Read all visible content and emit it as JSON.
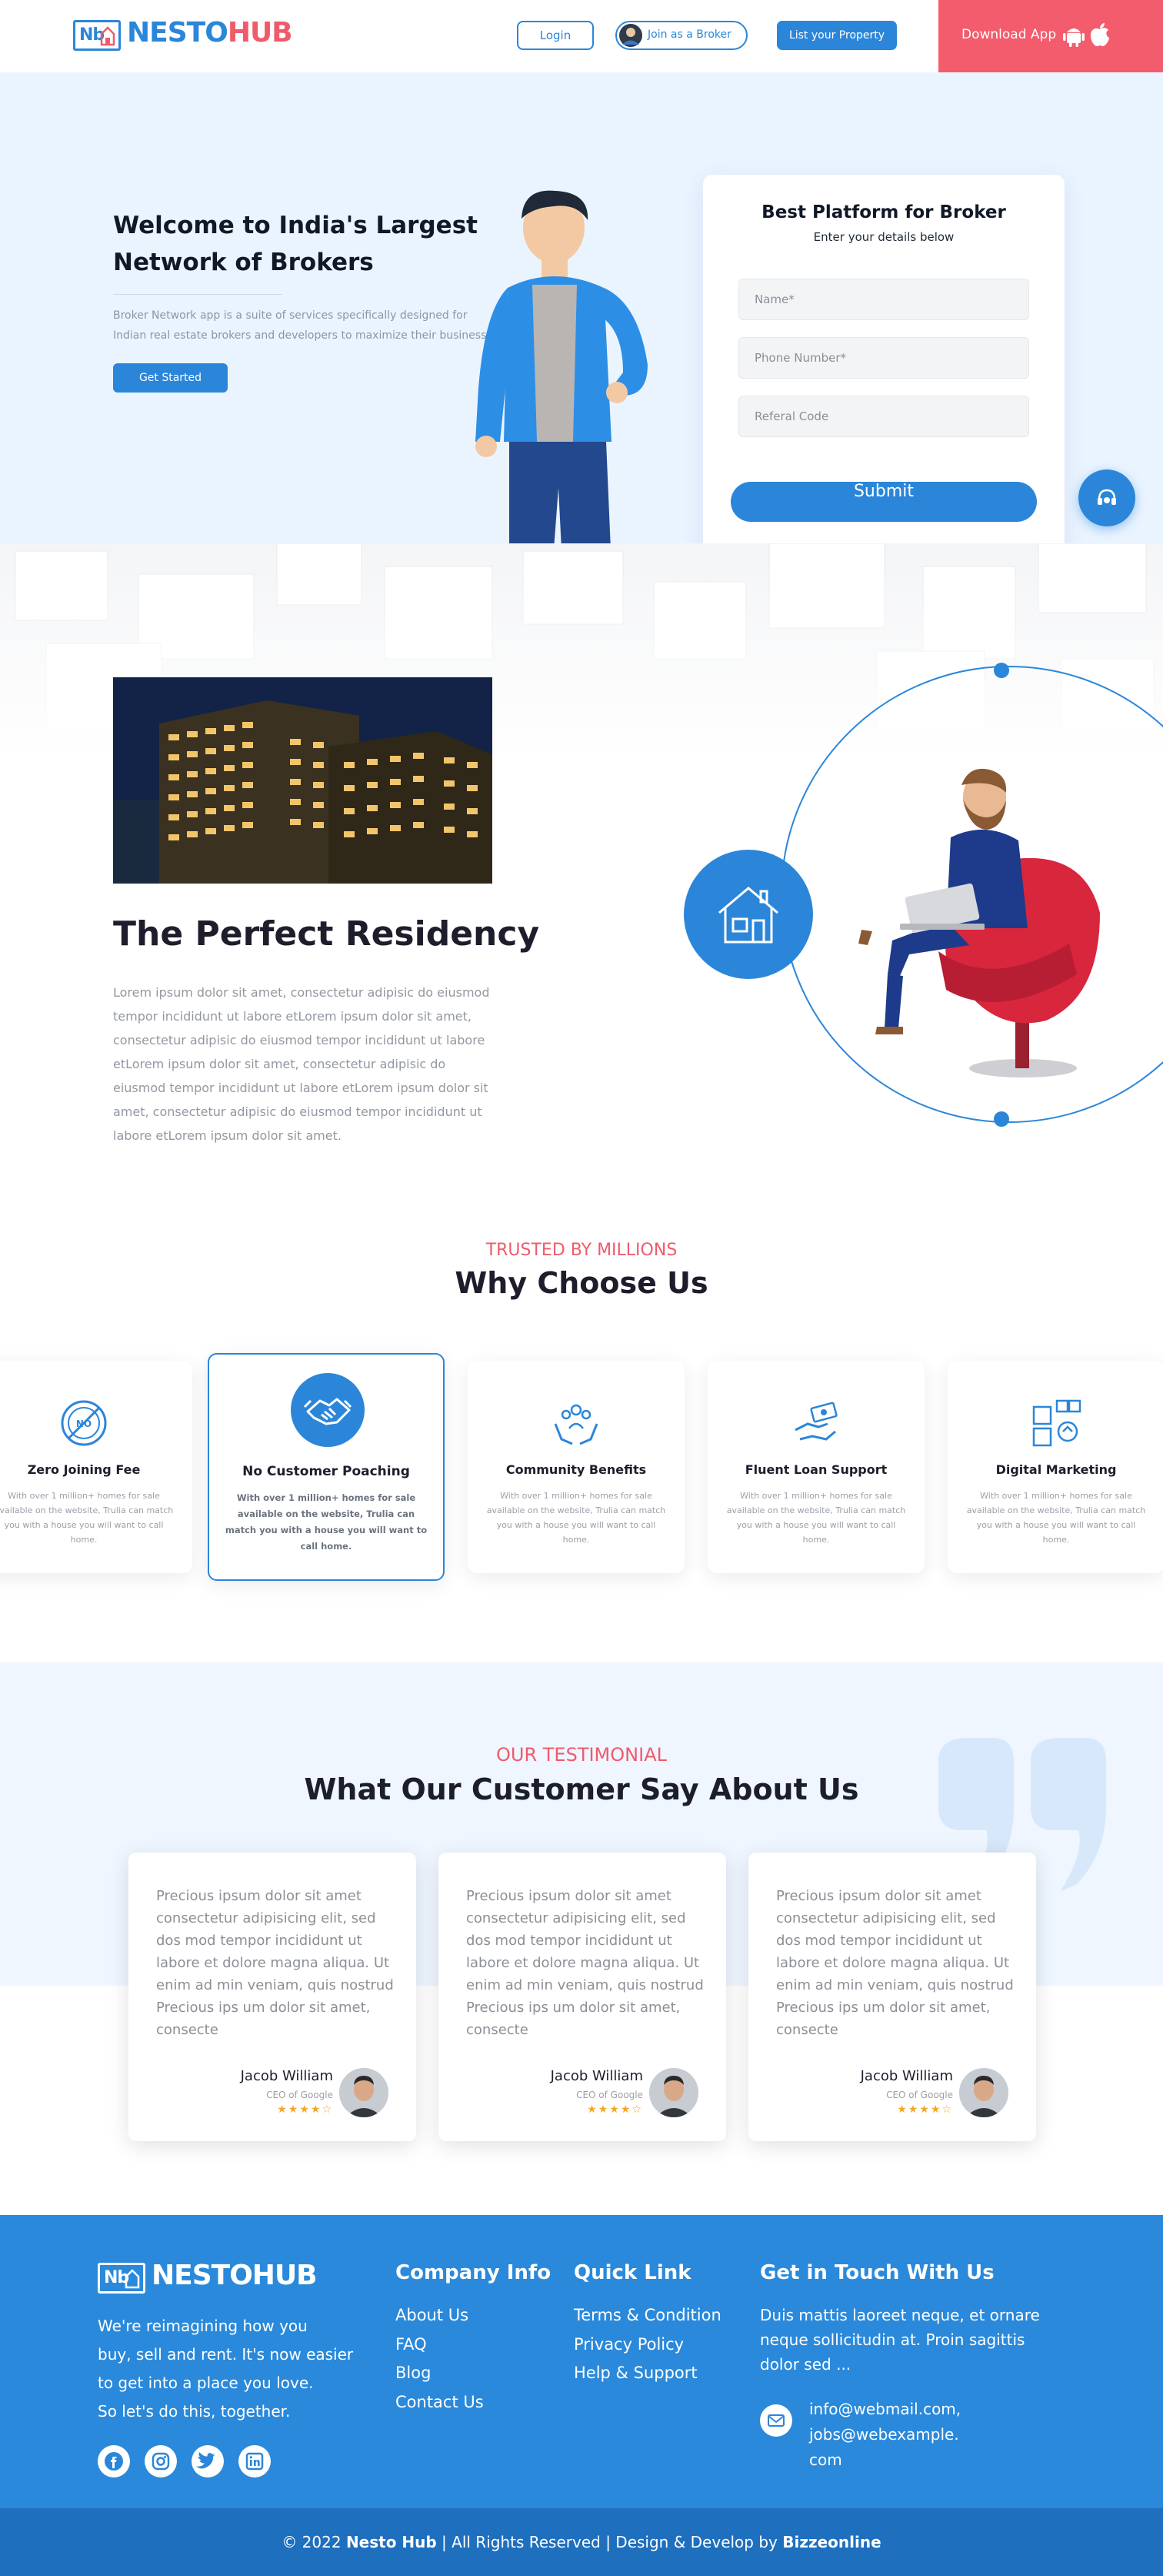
{
  "header": {
    "logo_nb": "Nb",
    "logo_word_a": "NESTO",
    "logo_word_b": "HUB",
    "login_label": "Login",
    "broker_label": "Join as a Broker",
    "property_label": "List your Property",
    "download_label": "Download App",
    "download_icons": [
      "android-icon",
      "apple-icon"
    ]
  },
  "hero": {
    "title_line1": "Welcome to India's Largest",
    "title_line2": "Network of Brokers",
    "desc_line1": "Broker Network app is a suite of services specifically designed for",
    "desc_line2": "Indian real estate brokers and developers to maximize their business.",
    "cta_label": "Get Started"
  },
  "form": {
    "title": "Best Platform for Broker",
    "subtitle": "Enter your details below",
    "name_placeholder": "Name*",
    "phone_placeholder": "Phone Number*",
    "referral_placeholder": "Referal Code",
    "submit_label": "Submit"
  },
  "residency": {
    "title": "The Perfect Residency",
    "body": "Lorem ipsum dolor sit amet, consectetur adipisic do eiusmod tempor incididunt ut labore etLorem ipsum dolor sit amet, consectetur adipisic do eiusmod tempor incididunt ut labore etLorem ipsum dolor sit amet, consectetur adipisic do eiusmod tempor incididunt ut labore etLorem ipsum dolor sit amet, consectetur adipisic do eiusmod tempor incididunt ut labore etLorem ipsum dolor sit amet."
  },
  "why": {
    "kicker": "TRUSTED BY MILLIONS",
    "title": "Why Choose Us",
    "features": [
      {
        "icon": "no-fee-icon",
        "title": "Zero Joining Fee",
        "text": "With over 1 million+ homes for sale available on the website, Trulia can match you with a house you will want to call home."
      },
      {
        "icon": "handshake-icon",
        "title": "No Customer Poaching",
        "text": "With over 1 million+ homes for sale available on the website, Trulia can match you with a house you will want to call home."
      },
      {
        "icon": "community-icon",
        "title": "Community Benefits",
        "text": "With over 1 million+ homes for sale available on the website, Trulia can match you with a house you will want to call home."
      },
      {
        "icon": "loan-icon",
        "title": "Fluent Loan Support",
        "text": "With over 1 million+ homes for sale available on the website, Trulia can match you with a house you will want to call home."
      },
      {
        "icon": "marketing-icon",
        "title": "Digital Marketing",
        "text": "With over 1 million+ homes for sale available on the website, Trulia can match you with a house you will want to call home."
      }
    ]
  },
  "testimonial": {
    "kicker": "OUR TESTIMONIAL",
    "title": "What Our Customer Say About Us",
    "cards": [
      {
        "quote": "Precious ipsum dolor sit amet consectetur adipisicing elit, sed dos mod tempor incididunt ut labore et dolore magna aliqua. Ut enim ad min veniam, quis nostrud Precious ips um dolor sit amet, consecte",
        "name": "Jacob William",
        "role": "CEO of Google",
        "stars": "★★★★☆",
        "rating": 4
      },
      {
        "quote": "Precious ipsum dolor sit amet consectetur adipisicing elit, sed dos mod tempor incididunt ut labore et dolore magna aliqua. Ut enim ad min veniam, quis nostrud Precious ips um dolor sit amet, consecte",
        "name": "Jacob William",
        "role": "CEO of Google",
        "stars": "★★★★☆",
        "rating": 4
      },
      {
        "quote": "Precious ipsum dolor sit amet consectetur adipisicing elit, sed dos mod tempor incididunt ut labore et dolore magna aliqua. Ut enim ad min veniam, quis nostrud Precious ips um dolor sit amet, consecte",
        "name": "Jacob William",
        "role": "CEO of Google",
        "stars": "★★★★☆",
        "rating": 4
      }
    ]
  },
  "footer": {
    "logo_nb": "Nb",
    "logo_text": "NESTOHUB",
    "tagline_lines": [
      "We're reimagining how you",
      "buy, sell and rent. It's now easier",
      "to get into a place you love.",
      "So let's do this, together."
    ],
    "company_title": "Company Info",
    "company_links": [
      "About Us",
      "FAQ",
      "Blog",
      "Contact Us"
    ],
    "quick_title": "Quick Link",
    "quick_links": [
      "Terms & Condition",
      "Privacy Policy",
      "Help & Support"
    ],
    "contact_title": "Get in Touch With Us",
    "contact_text_lines": [
      "Duis mattis laoreet neque, et ornare",
      "neque sollicitudin at. Proin sagittis",
      "dolor sed ..."
    ],
    "email_lines": [
      "info@webmail.com,",
      "jobs@webexample.",
      "com"
    ],
    "social_icons": [
      "facebook-icon",
      "instagram-icon",
      "twitter-icon",
      "linkedin-icon"
    ],
    "copyright_pre": "© 2022 ",
    "copyright_brand": "Nesto Hub",
    "copyright_mid": " | All Rights Reserved | Design & Develop by ",
    "copyright_dev": "Bizzeonline"
  },
  "colors": {
    "primary": "#2b86d9",
    "accent": "#ef5b6b",
    "hero_bg": "#eaf4ff",
    "footer_bg": "#2a89db",
    "bottom_bar": "#1e6fbe"
  }
}
